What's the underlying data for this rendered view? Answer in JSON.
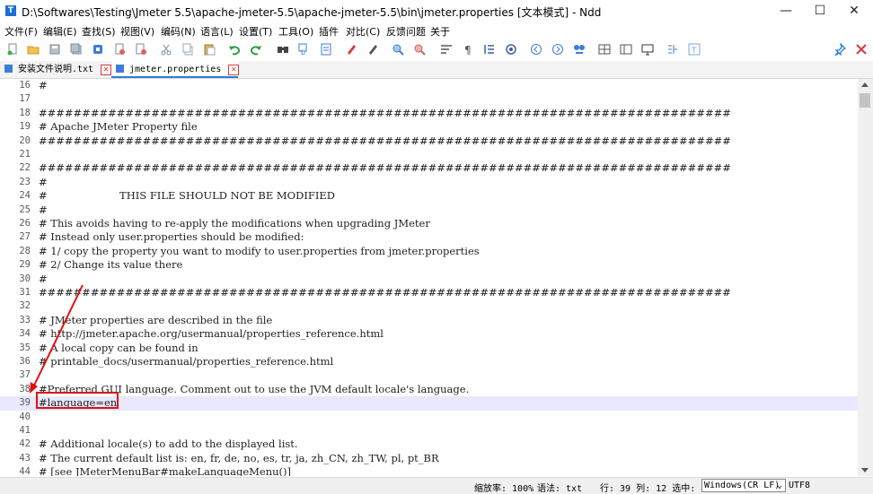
{
  "window": {
    "title": "D:\\Softwares\\Testing\\Jmeter 5.5\\apache-jmeter-5.5\\apache-jmeter-5.5\\bin\\jmeter.properties [文本模式] - Ndd",
    "app_icon_letter": "T",
    "minimize": "—",
    "maximize": "☐",
    "close": "✕"
  },
  "menu": [
    "文件(F)",
    "编辑(E)",
    "查找(S)",
    "视图(V)",
    "编码(N)",
    "语言(L)",
    "设置(T)",
    "工具(O)",
    "插件",
    "对比(C)",
    "反馈问题",
    "关于"
  ],
  "toolbar": {
    "icons": [
      "new-file-icon",
      "open-folder-icon",
      "save-icon",
      "save-all-icon",
      "close-file-icon",
      "close-all-icon",
      "cut-icon",
      "copy-icon",
      "paste-icon",
      "undo-icon",
      "redo-icon",
      "find-icon",
      "replace-icon",
      "goto-icon",
      "mark-icon",
      "clear-mark-icon",
      "zoom-in-icon",
      "zoom-out-icon",
      "wrap-icon",
      "show-symbols-icon",
      "indent-guide-icon",
      "bookmark-icon",
      "prev-icon",
      "next-icon",
      "compare-icon",
      "table-icon",
      "panel-icon",
      "monitor-icon",
      "outline-icon",
      "text-mode-icon"
    ],
    "pin_icon": "pin-icon",
    "close_icon": "close-red-icon"
  },
  "tabs": [
    {
      "label": "安装文件说明.txt",
      "active": false
    },
    {
      "label": "jmeter.properties",
      "active": true
    }
  ],
  "editor": {
    "current_line": 39,
    "lines": [
      {
        "n": "16",
        "text": "#"
      },
      {
        "n": "17",
        "text": ""
      },
      {
        "n": "18",
        "text": "################################################################################"
      },
      {
        "n": "19",
        "text": "# Apache JMeter Property file"
      },
      {
        "n": "20",
        "text": "################################################################################"
      },
      {
        "n": "21",
        "text": ""
      },
      {
        "n": "22",
        "text": "################################################################################"
      },
      {
        "n": "23",
        "text": "#"
      },
      {
        "n": "24",
        "text": "#                      THIS FILE SHOULD NOT BE MODIFIED"
      },
      {
        "n": "25",
        "text": "#"
      },
      {
        "n": "26",
        "text": "# This avoids having to re-apply the modifications when upgrading JMeter"
      },
      {
        "n": "27",
        "text": "# Instead only user.properties should be modified:"
      },
      {
        "n": "28",
        "text": "# 1/ copy the property you want to modify to user.properties from jmeter.properties"
      },
      {
        "n": "29",
        "text": "# 2/ Change its value there"
      },
      {
        "n": "30",
        "text": "#"
      },
      {
        "n": "31",
        "text": "################################################################################"
      },
      {
        "n": "32",
        "text": ""
      },
      {
        "n": "33",
        "text": "# JMeter properties are described in the file"
      },
      {
        "n": "34",
        "text": "# http://jmeter.apache.org/usermanual/properties_reference.html"
      },
      {
        "n": "35",
        "text": "# A local copy can be found in"
      },
      {
        "n": "36",
        "text": "# printable_docs/usermanual/properties_reference.html"
      },
      {
        "n": "37",
        "text": ""
      },
      {
        "n": "38",
        "text": "#Preferred GUI language. Comment out to use the JVM default locale's language."
      },
      {
        "n": "39",
        "text": "#language=en"
      },
      {
        "n": "40",
        "text": ""
      },
      {
        "n": "41",
        "text": ""
      },
      {
        "n": "42",
        "text": "# Additional locale(s) to add to the displayed list."
      },
      {
        "n": "43",
        "text": "# The current default list is: en, fr, de, no, es, tr, ja, zh_CN, zh_TW, pl, pt_BR"
      },
      {
        "n": "44",
        "text": "# [see JMeterMenuBar#makeLanguageMenu()]"
      }
    ]
  },
  "status": {
    "zoom": "缩放率: 100%",
    "syntax": "语法: txt",
    "position": "行: 39 列: 12 选中: 0",
    "eol": "Windows(CR LF)",
    "encoding": "UTF8"
  },
  "colors": {
    "current_line": "#e8e8ff",
    "annotation": "#e01010",
    "tab_accent": "#2a7fd6"
  }
}
